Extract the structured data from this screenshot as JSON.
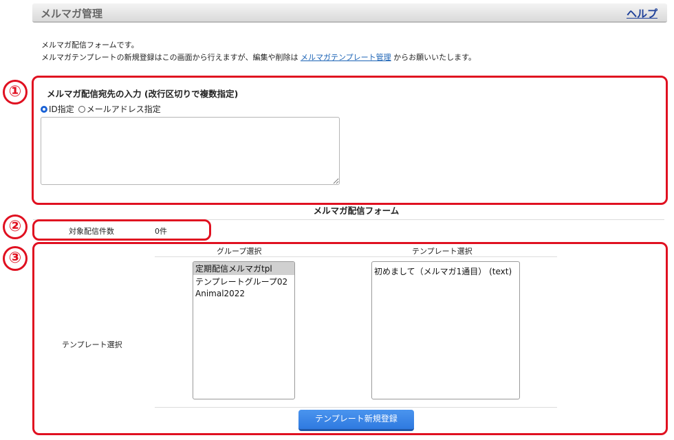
{
  "header": {
    "title": "メルマガ管理",
    "help_label": "ヘルプ"
  },
  "intro": {
    "line1": "メルマガ配信フォームです。",
    "line2_prefix": "メルマガテンプレートの新規登録はこの画面から行えますが、編集や削除は",
    "line2_link": "メルマガテンプレート管理",
    "line2_suffix": "からお願いいたします。"
  },
  "markers": {
    "m1": "①",
    "m2": "②",
    "m3": "③"
  },
  "recipients": {
    "title": "メルマガ配信宛先の入力 (改行区切りで複数指定)",
    "radio_id_label": "ID指定",
    "radio_email_label": "メールアドレス指定",
    "selected": "ID指定",
    "textarea_value": ""
  },
  "form_title": "メルマガ配信フォーム",
  "count": {
    "label": "対象配信件数",
    "value": "0件"
  },
  "template": {
    "row_label": "テンプレート選択",
    "group_header": "グループ選択",
    "template_header": "テンプレート選択",
    "groups": [
      {
        "label": "定期配信メルマガtpl",
        "selected": true
      },
      {
        "label": "テンプレートグループ02",
        "selected": false
      },
      {
        "label": "Animal2022",
        "selected": false
      }
    ],
    "templates": [
      {
        "label": "初めまして（メルマガ1通目） (text)",
        "selected": false
      }
    ],
    "register_button": "テンプレート新規登録"
  },
  "colors": {
    "accent_red": "#e01020",
    "link_blue": "#1a62b5",
    "button_blue": "#3a85e8"
  }
}
